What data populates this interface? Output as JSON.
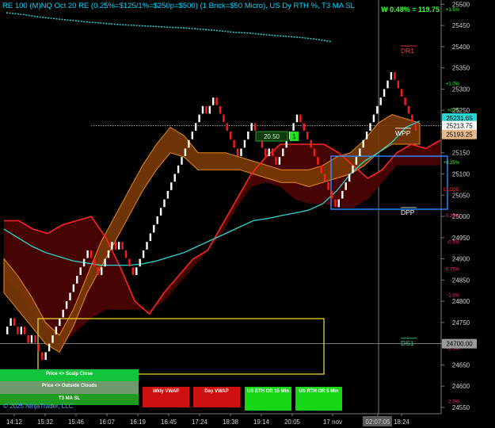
{
  "header": {
    "title": "RE 100 (M)NQ Oct 20 RE (0.25%=$125/1%=$250p=$500)  (1 Brick=$50 Micro), US Dy RTH %, T3 MA SL",
    "pnl": "W 0.48% = 119.75"
  },
  "buttons": {
    "scalp": "Price <> Scalp Close",
    "outside": "Price <> Outside Clouds",
    "t3": "T3 MA SL",
    "wkly_vwap": "Wkly VWAP",
    "day_vwap": "Day VWAP",
    "us_eth": "US ETH OR 15 Min",
    "us_rth": "US RTH OR 5 Min"
  },
  "footer": {
    "copyright": "© 2025 NinjaTrader, LLC"
  },
  "colors": {
    "background": "#000000",
    "up_brick": "#ffffff",
    "down_brick": "#ff1a1a",
    "vwap_line": "#2ad4d4",
    "upper_band": "#ff2222",
    "cloud_orange": "#ff9a1a",
    "cloud_red": "#4a0404",
    "box_yellow": "#e6d230",
    "box_blue": "#2f8cff",
    "positive_pct": "#33ff33",
    "negative_pct": "#ff3380"
  },
  "chart_data": {
    "type": "renko",
    "title": "RE 100 (M)NQ Oct 20 RE (0.25%=$125/1%=$250p=$500)  (1 Brick=$50 Micro), US Dy RTH %, T3 MA SL",
    "x_ticks": [
      "14:12",
      "15:32",
      "15:46",
      "16:07",
      "16:19",
      "16:45",
      "17:24",
      "18:38",
      "19:14",
      "20:05",
      "17 nov",
      "02:07:05",
      "18:24"
    ],
    "y_ticks": [
      24550,
      24600,
      24650,
      24700,
      24750,
      24800,
      24850,
      24900,
      24950,
      25000,
      25050,
      25100,
      25150,
      25200,
      25250,
      25300,
      25350,
      25400,
      25450,
      25500
    ],
    "ylim": [
      24535,
      25510
    ],
    "price_tags": [
      {
        "label": "25231.65",
        "value": 25231.65,
        "color": "#2ad4d4"
      },
      {
        "label": "25213.75",
        "value": 25213.75,
        "color": "#ffffff"
      },
      {
        "label": "25193.25",
        "value": 25193.25,
        "color": "#e8b888"
      },
      {
        "label": "24700.00",
        "value": 24700.0,
        "color": "#9a9a9a"
      }
    ],
    "percent_levels": [
      {
        "label": "+1.5%",
        "value": 25488,
        "color": "#33ff33"
      },
      {
        "label": "+1.0%",
        "value": 25313,
        "color": "#33ff33"
      },
      {
        "label": "+0.75",
        "value": 25250,
        "color": "#33ff33"
      },
      {
        "label": "+0.5%",
        "value": 25187,
        "color": "#33ff33"
      },
      {
        "label": "+0.25%",
        "value": 25127,
        "color": "#33ff33"
      },
      {
        "label": "CLOSE",
        "value": 25064,
        "color": "#ff3333"
      },
      {
        "label": "-0.25%",
        "value": 25002,
        "color": "#ff3380"
      },
      {
        "label": "-0.5%",
        "value": 24939,
        "color": "#ff3380"
      },
      {
        "label": "-0.75%",
        "value": 24876,
        "color": "#ff3380"
      },
      {
        "label": "-1.0%",
        "value": 24814,
        "color": "#ff3380"
      },
      {
        "label": "-1.5%",
        "value": 24689,
        "color": "#ff3380"
      },
      {
        "label": "-2.0%",
        "value": 24564,
        "color": "#ff3380"
      }
    ],
    "level_labels": [
      {
        "label": "DR1",
        "value": 25385,
        "color": "#ff3333"
      },
      {
        "label": "WPP",
        "value": 25191,
        "color": "#ffffff"
      },
      {
        "label": "DPP",
        "value": 25004,
        "color": "#ffffff"
      },
      {
        "label": "DS1",
        "value": 24696,
        "color": "#33cc88"
      }
    ],
    "value_boxes": [
      {
        "label": "20.50",
        "value": 25195
      },
      {
        "label": "1",
        "value": 25195
      }
    ],
    "brick_closes": [
      24740,
      24760,
      24740,
      24720,
      24740,
      24720,
      24700,
      24720,
      24700,
      24680,
      24660,
      24680,
      24700,
      24720,
      24740,
      24760,
      24780,
      24800,
      24820,
      24840,
      24860,
      24880,
      24900,
      24920,
      24900,
      24880,
      24860,
      24880,
      24900,
      24920,
      24940,
      24920,
      24940,
      24920,
      24900,
      24880,
      24860,
      24880,
      24900,
      24920,
      24940,
      24960,
      24980,
      25000,
      25020,
      25040,
      25060,
      25080,
      25100,
      25120,
      25140,
      25160,
      25180,
      25200,
      25220,
      25240,
      25260,
      25240,
      25260,
      25280,
      25260,
      25240,
      25220,
      25200,
      25180,
      25160,
      25140,
      25160,
      25180,
      25200,
      25220,
      25200,
      25180,
      25160,
      25140,
      25160,
      25140,
      25120,
      25140,
      25160,
      25180,
      25200,
      25220,
      25240,
      25220,
      25200,
      25180,
      25160,
      25140,
      25120,
      25100,
      25080,
      25060,
      25040,
      25020,
      25040,
      25060,
      25080,
      25100,
      25120,
      25140,
      25160,
      25180,
      25200,
      25220,
      25240,
      25260,
      25280,
      25300,
      25320,
      25340,
      25320,
      25300,
      25280,
      25260,
      25240,
      25220,
      25200
    ],
    "series": [
      {
        "name": "VWAP",
        "x_frac_values": [],
        "values": [
          24970,
          24950,
          24930,
          24915,
          24905,
          24895,
          24890,
          24885,
          24885,
          24885,
          24888,
          24895,
          24905,
          24915,
          24930,
          24945,
          24960,
          24975,
          24990,
          24995,
          25002,
          25008,
          25015,
          25030,
          25060,
          25100,
          25130,
          25150,
          25175,
          25210,
          25225
        ]
      }
    ],
    "upper_line": [
      24990,
      24990,
      24970,
      24960,
      24980,
      24990,
      25000,
      24950,
      24880,
      24800,
      24770,
      24820,
      24860,
      24900,
      24920,
      24980,
      25040,
      25100,
      25140,
      25170,
      25170,
      25170,
      25170,
      25150,
      25120,
      25090,
      25110,
      25150,
      25170,
      25160,
      25180
    ],
    "lower_band": [
      24860,
      24820,
      24770,
      24740,
      24700,
      24730,
      24760,
      24780,
      24780,
      24780,
      24780,
      24800,
      24840,
      24880,
      24920,
      24960,
      25020,
      25070,
      25080,
      25070,
      25040,
      25030,
      25030,
      25020,
      25020,
      25040,
      25080,
      25120,
      25120,
      25120,
      25120
    ],
    "cloud_top": [
      24900,
      24860,
      24810,
      24750,
      24720,
      24780,
      24860,
      24940,
      25000,
      25060,
      25120,
      25170,
      25210,
      25190,
      25150,
      25150,
      25150,
      25140,
      25130,
      25120,
      25110,
      25110,
      25110,
      25120,
      25140,
      25150,
      25180,
      25220,
      25240,
      25230,
      25220
    ],
    "cloud_bottom": [
      24820,
      24780,
      24740,
      24700,
      24680,
      24740,
      24820,
      24880,
      24940,
      25000,
      25060,
      25110,
      25150,
      25140,
      25110,
      25110,
      25110,
      25110,
      25100,
      25090,
      25080,
      25080,
      25070,
      25080,
      25090,
      25100,
      25120,
      25150,
      25170,
      25170,
      25170
    ],
    "teal_high_line": [
      25480,
      25476,
      25470,
      25466,
      25462,
      25458,
      25455,
      25452,
      25450,
      25448,
      25446,
      25444,
      25441,
      25438,
      25434,
      25432,
      25428,
      25425,
      25422,
      25418,
      25412
    ]
  }
}
